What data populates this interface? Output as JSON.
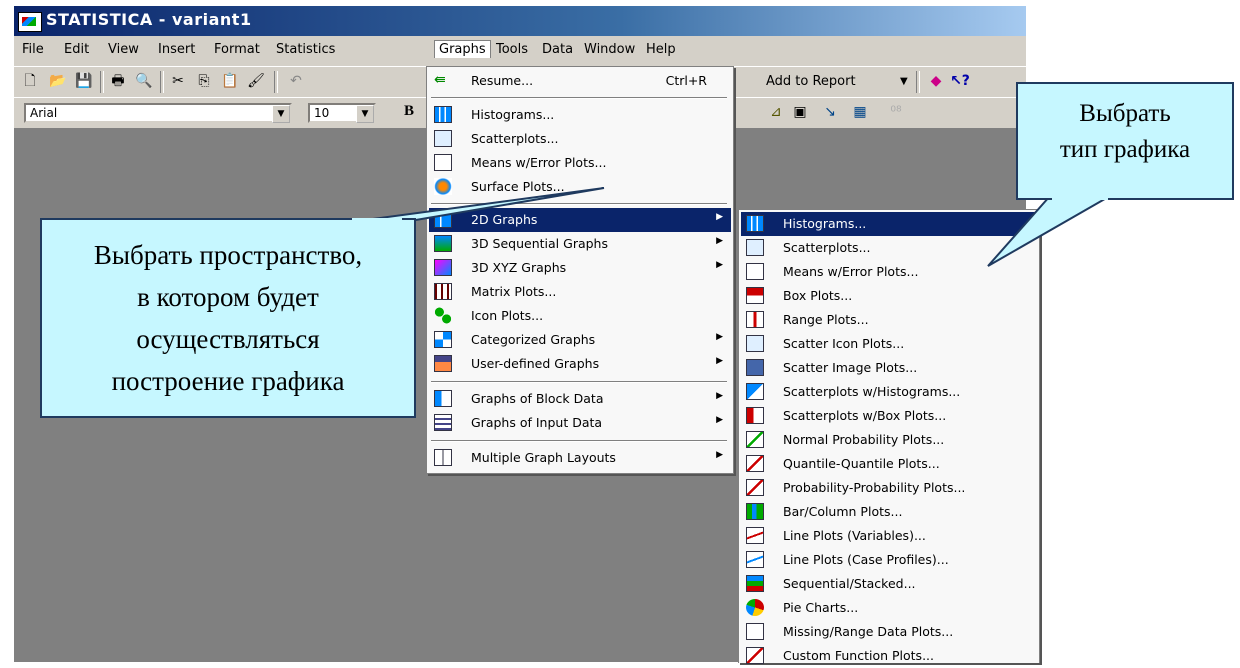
{
  "window": {
    "title": "STATISTICA - variant1"
  },
  "menubar": [
    "File",
    "Edit",
    "View",
    "Insert",
    "Format",
    "Statistics",
    "Graphs",
    "Tools",
    "Data",
    "Window",
    "Help"
  ],
  "toolbar": {
    "font_name": "Arial",
    "font_size": "10",
    "add_to_report": "Add to Report",
    "bold": "B"
  },
  "graphs_menu": {
    "resume": {
      "label": "Resume...",
      "shortcut": "Ctrl+R"
    },
    "group1": [
      "Histograms...",
      "Scatterplots...",
      "Means w/Error Plots...",
      "Surface Plots..."
    ],
    "group2": [
      "2D Graphs",
      "3D Sequential Graphs",
      "3D XYZ Graphs",
      "Matrix Plots...",
      "Icon Plots...",
      "Categorized Graphs",
      "User-defined Graphs"
    ],
    "group3": [
      "Graphs of Block Data",
      "Graphs of Input Data"
    ],
    "group4": [
      "Multiple Graph Layouts"
    ]
  },
  "submenu_2d": [
    "Histograms...",
    "Scatterplots...",
    "Means w/Error Plots...",
    "Box Plots...",
    "Range Plots...",
    "Scatter Icon Plots...",
    "Scatter Image Plots...",
    "Scatterplots w/Histograms...",
    "Scatterplots w/Box Plots...",
    "Normal Probability Plots...",
    "Quantile-Quantile Plots...",
    "Probability-Probability Plots...",
    "Bar/Column Plots...",
    "Line Plots (Variables)...",
    "Line Plots (Case Profiles)...",
    "Sequential/Stacked...",
    "Pie Charts...",
    "Missing/Range Data Plots...",
    "Custom Function Plots..."
  ],
  "callouts": {
    "space": [
      "Выбрать пространство,",
      "в котором будет",
      "осуществляться",
      "построение графика"
    ],
    "type": [
      "Выбрать",
      "тип графика"
    ]
  },
  "colors": {
    "callout_fill": "#c6f7ff",
    "highlight": "#0a246a",
    "titlebar": "#0a246a"
  }
}
